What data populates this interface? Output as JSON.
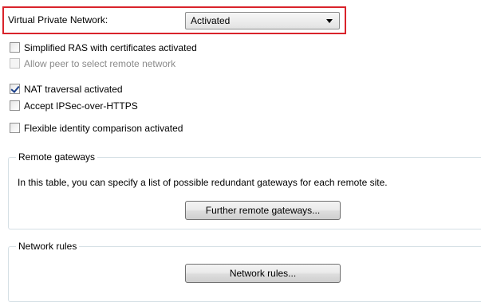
{
  "vpn": {
    "label": "Virtual Private Network:",
    "selected_value": "Activated"
  },
  "options": [
    {
      "label": "Simplified RAS with certificates activated",
      "checked": false,
      "enabled": true
    },
    {
      "label": "Allow peer to select remote network",
      "checked": false,
      "enabled": false
    },
    {
      "label": "NAT traversal activated",
      "checked": true,
      "enabled": true
    },
    {
      "label": "Accept IPSec-over-HTTPS",
      "checked": false,
      "enabled": true
    },
    {
      "label": "Flexible identity comparison activated",
      "checked": false,
      "enabled": true
    }
  ],
  "remote_gateways": {
    "title": "Remote gateways",
    "description": "In this table, you can specify a list of possible redundant gateways for each remote site.",
    "button_label": "Further remote gateways..."
  },
  "network_rules": {
    "title": "Network rules",
    "button_label": "Network rules..."
  },
  "colors": {
    "highlight": "#d9232b",
    "group_border": "#d5dfe5"
  }
}
